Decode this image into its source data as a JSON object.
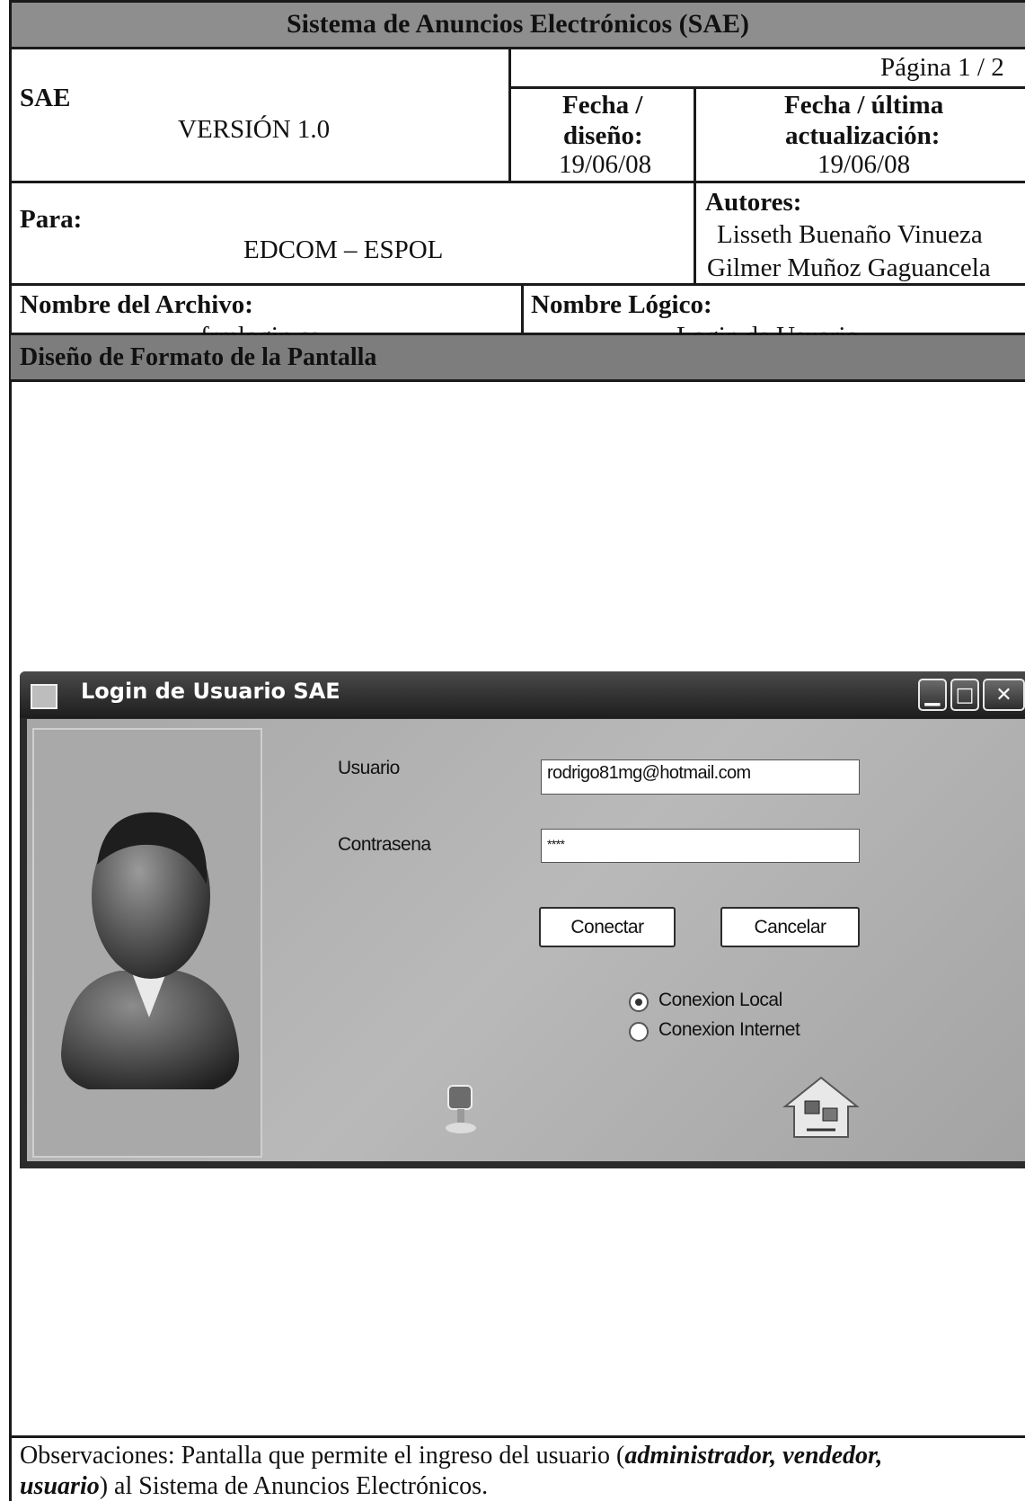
{
  "header": {
    "system_title": "Sistema de Anuncios Electrónicos (SAE)",
    "page": "Página  1 / 2",
    "project_label": "SAE",
    "version": "VERSIÓN 1.0",
    "design_date_label_1": "Fecha /",
    "design_date_label_2": "diseño:",
    "design_date": "19/06/08",
    "update_date_label_1": "Fecha / última",
    "update_date_label_2": "actualización:",
    "update_date": "19/06/08",
    "for_label": "Para:",
    "for_value": "EDCOM – ESPOL",
    "authors_label": "Autores:",
    "authors": [
      "Lisseth Buenaño Vinueza",
      "Gilmer Muñoz Gaguancela"
    ],
    "file_label": "Nombre del Archivo:",
    "file_value": "frmlogin.cs",
    "logical_label": "Nombre Lógico:",
    "logical_value": "Login de Usuario"
  },
  "section_title": "Diseño de Formato de la Pantalla",
  "login_window": {
    "title": "Login de Usuario SAE",
    "controls": {
      "minimize": "▁",
      "maximize": "□",
      "close": "✕"
    },
    "user_label": "Usuario",
    "user_value": "rodrigo81mg@hotmail.com",
    "password_label": "Contrasena",
    "password_value": "****",
    "connect_button": "Conectar",
    "cancel_button": "Cancelar",
    "radio_local": "Conexion Local",
    "radio_internet": "Conexion Internet",
    "selected_connection": "Conexion Local",
    "icons": [
      "user-avatar-icon",
      "local-connection-icon",
      "internet-connection-icon"
    ]
  },
  "observations": {
    "prefix": "Observaciones: Pantalla que permite el ingreso del usuario (",
    "roles_1": "administrador, vendedor,",
    "roles_2": "usuario",
    "suffix": ") al Sistema de Anuncios Electrónicos."
  }
}
